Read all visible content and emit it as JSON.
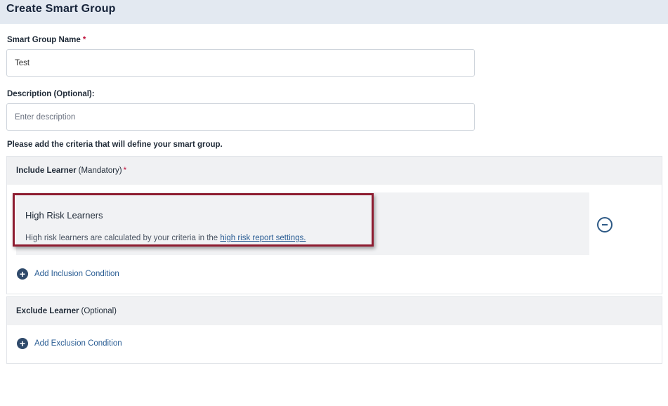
{
  "header": {
    "title": "Create Smart Group"
  },
  "form": {
    "name_label": "Smart Group Name",
    "name_required": "*",
    "name_value": "Test",
    "description_label": "Description (Optional):",
    "description_placeholder": "Enter description",
    "criteria_hint": "Please add the criteria that will define your smart group."
  },
  "include": {
    "title": "Include Learner",
    "qualifier": "(Mandatory)",
    "required": "*",
    "criterion": {
      "title": "High Risk Learners",
      "description": "High risk learners are calculated by your criteria in the",
      "link_text": "high risk report settings."
    },
    "add_label": "Add Inclusion Condition"
  },
  "exclude": {
    "title": "Exclude Learner",
    "qualifier": "(Optional)",
    "add_label": "Add Exclusion Condition"
  },
  "colors": {
    "accent": "#2a5d94",
    "highlight": "#8e1c30",
    "required": "#c0123c"
  }
}
